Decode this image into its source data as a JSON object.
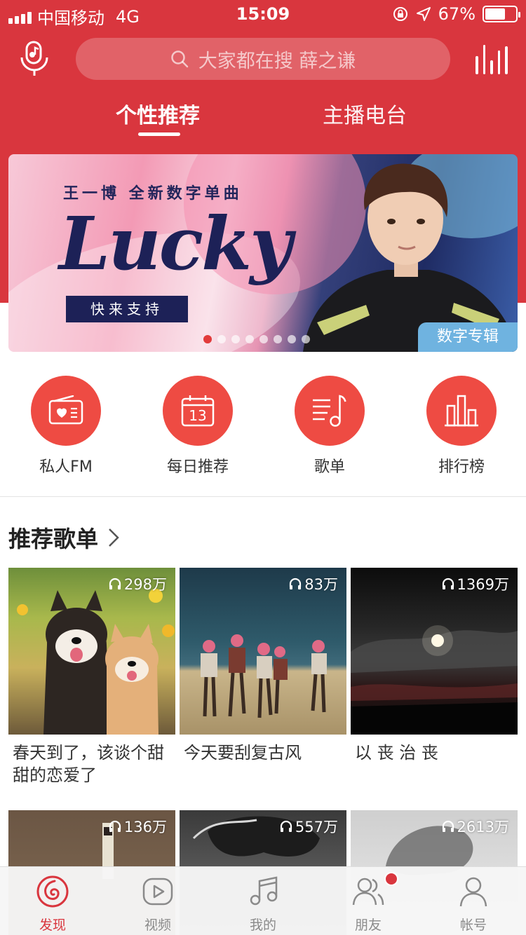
{
  "status_bar": {
    "carrier": "中国移动",
    "network": "4G",
    "time": "15:09",
    "battery": "67%",
    "battery_level": 0.67
  },
  "header": {
    "search_placeholder": "大家都在搜 薛之谦",
    "tabs": [
      {
        "label": "个性推荐",
        "active": true
      },
      {
        "label": "主播电台",
        "active": false
      }
    ]
  },
  "banner": {
    "subtitle": "王一博  全新数字单曲",
    "title": "Lucky",
    "cta": "快来支持",
    "badge": "数字专辑",
    "page_count": 8,
    "active_page": 0
  },
  "quick_entries": [
    {
      "label": "私人FM",
      "icon": "radio-icon"
    },
    {
      "label": "每日推荐",
      "icon": "calendar-icon",
      "day": "13"
    },
    {
      "label": "歌单",
      "icon": "playlist-icon"
    },
    {
      "label": "排行榜",
      "icon": "chart-icon"
    }
  ],
  "recommended": {
    "title": "推荐歌单",
    "playlists": [
      {
        "name": "春天到了，该谈个甜甜的恋爱了",
        "plays": "298万"
      },
      {
        "name": "今天要刮复古风",
        "plays": "83万"
      },
      {
        "name": "以 丧 治 丧",
        "plays": "1369万"
      },
      {
        "name": "",
        "plays": "136万"
      },
      {
        "name": "",
        "plays": "557万"
      },
      {
        "name": "",
        "plays": "2613万"
      }
    ]
  },
  "tab_bar": [
    {
      "label": "发现",
      "icon": "discover-icon",
      "active": true
    },
    {
      "label": "视频",
      "icon": "video-icon",
      "active": false
    },
    {
      "label": "我的",
      "icon": "music-icon",
      "active": false
    },
    {
      "label": "朋友",
      "icon": "friends-icon",
      "active": false
    },
    {
      "label": "帐号",
      "icon": "account-icon",
      "active": false
    }
  ],
  "colors": {
    "brand_red": "#d9363e",
    "icon_red": "#ee4b43",
    "banner_badge": "#6fb3e0"
  }
}
